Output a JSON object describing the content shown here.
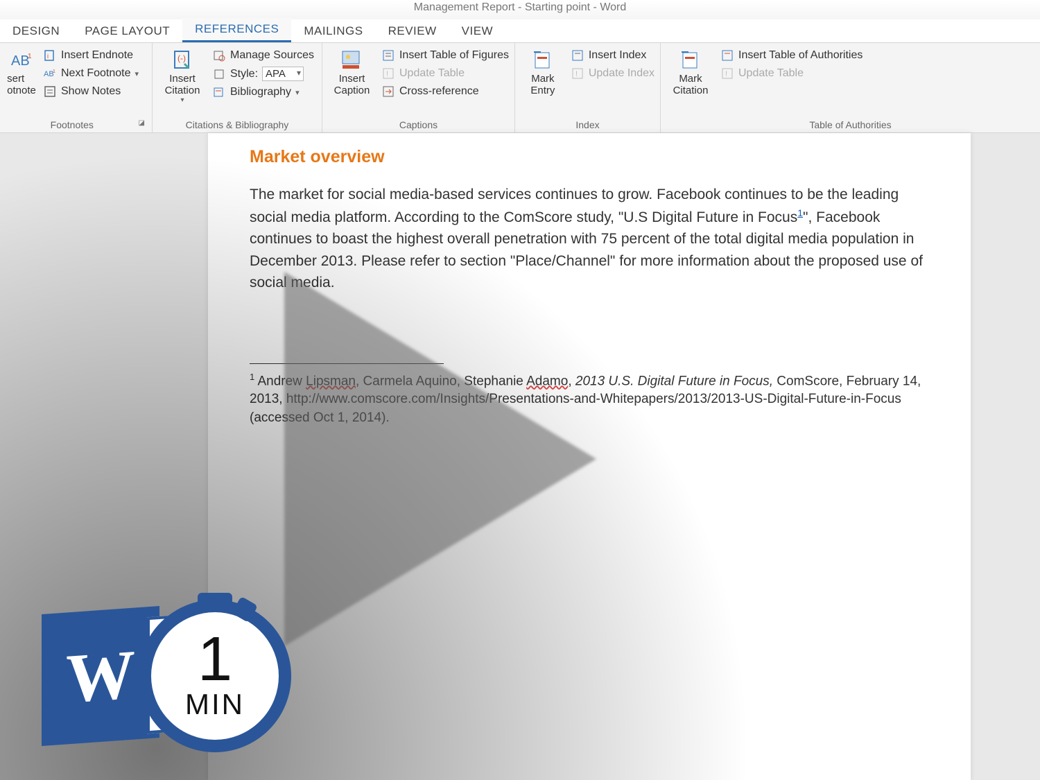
{
  "title": "Management Report - Starting point - Word",
  "tabs": [
    "DESIGN",
    "PAGE LAYOUT",
    "REFERENCES",
    "MAILINGS",
    "REVIEW",
    "VIEW"
  ],
  "active_tab_index": 2,
  "ribbon": {
    "footnotes": {
      "big_partial_top": "sert",
      "big_partial_bottom": "otnote",
      "insert_endnote": "Insert Endnote",
      "next_footnote": "Next Footnote",
      "show_notes": "Show Notes",
      "label": "Footnotes"
    },
    "citations": {
      "insert_citation": "Insert\nCitation",
      "manage_sources": "Manage Sources",
      "style_label": "Style:",
      "style_value": "APA",
      "bibliography": "Bibliography",
      "label": "Citations & Bibliography"
    },
    "captions": {
      "insert_caption": "Insert\nCaption",
      "insert_tof": "Insert Table of Figures",
      "update_table": "Update Table",
      "cross_ref": "Cross-reference",
      "label": "Captions"
    },
    "index": {
      "mark_entry": "Mark\nEntry",
      "insert_index": "Insert Index",
      "update_index": "Update Index",
      "label": "Index"
    },
    "toa": {
      "mark_citation": "Mark\nCitation",
      "insert_toa": "Insert Table of Authorities",
      "update_table": "Update Table",
      "label": "Table of Authorities"
    }
  },
  "document": {
    "heading": "Market overview",
    "para_part1": "The market for social media-based services continues to grow. Facebook continues to be the leading social media platform.  According to the ComScore study, \"U.S Digital Future in Focus",
    "para_sup": "1",
    "para_part2": "\", Facebook continues to boast the highest overall penetration with 75 percent of the total digital media population in December 2013. Please refer to section \"Place/Channel\" for more information about the proposed use of social media.",
    "footnote_num": "1",
    "footnote_a": " Andrew ",
    "footnote_name1": "Lipsman",
    "footnote_b": ", Carmela Aquino, Stephanie ",
    "footnote_name2": "Adamo",
    "footnote_c": ", ",
    "footnote_italic": "2013 U.S. Digital Future in Focus,",
    "footnote_d": " ComScore, February 14, 2013, http://www.comscore.com/Insights/Presentations-and-Whitepapers/2013/2013-US-Digital-Future-in-Focus (accessed Oct 1, 2014)."
  },
  "badge": {
    "num": "1",
    "min": "MIN",
    "w": "W"
  }
}
